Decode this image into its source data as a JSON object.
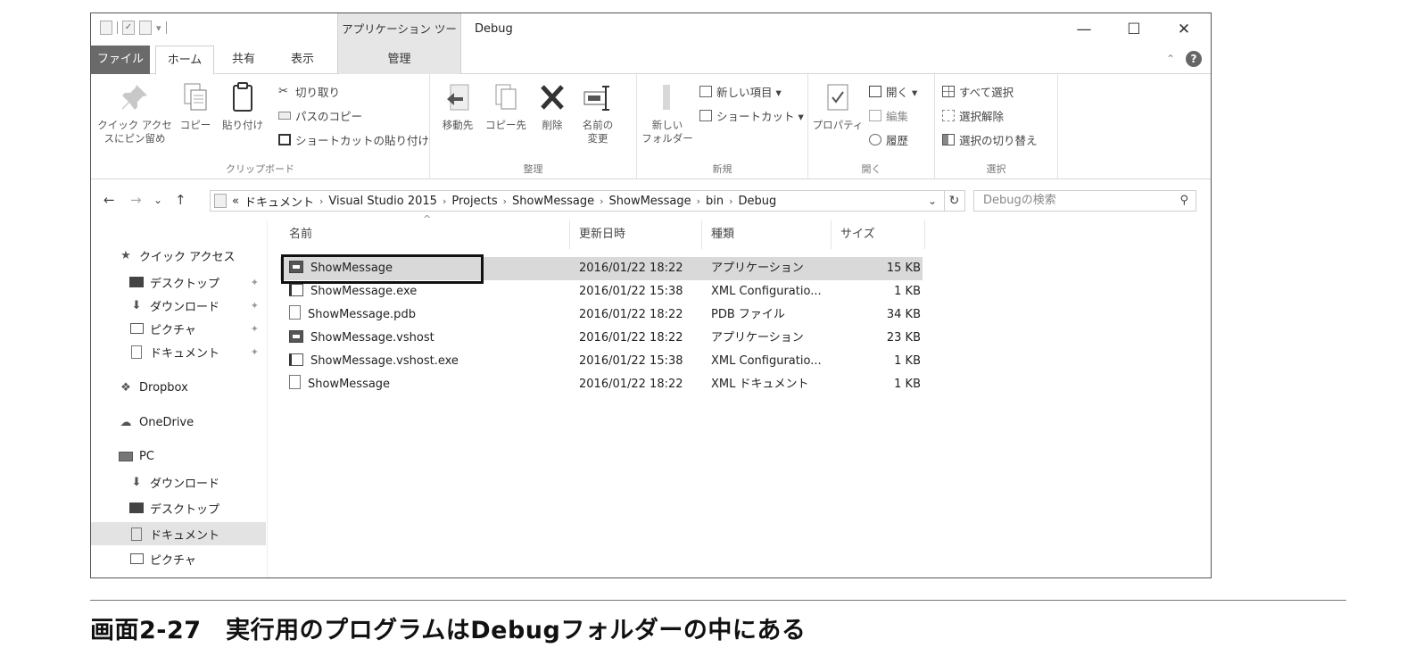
{
  "window": {
    "title": "Debug",
    "context_tab_group": "アプリケーション ツール",
    "minimize": "—",
    "maximize": "☐",
    "close": "✕"
  },
  "tabs": {
    "file": "ファイル",
    "home": "ホーム",
    "share": "共有",
    "view": "表示",
    "manage": "管理"
  },
  "ribbon": {
    "clipboard": {
      "group": "クリップボード",
      "pin_line1": "クイック アクセ",
      "pin_line2": "スにピン留め",
      "copy": "コピー",
      "paste": "貼り付け",
      "cut": "切り取り",
      "copy_path": "パスのコピー",
      "paste_shortcut": "ショートカットの貼り付け"
    },
    "organize": {
      "group": "整理",
      "move_to": "移動先",
      "copy_to": "コピー先",
      "delete": "削除",
      "rename_line1": "名前の",
      "rename_line2": "変更"
    },
    "new": {
      "group": "新規",
      "new_folder_line1": "新しい",
      "new_folder_line2": "フォルダー",
      "new_item": "新しい項目 ▾",
      "easy_access": "ショートカット ▾"
    },
    "open": {
      "group": "開く",
      "properties": "プロパティ",
      "open": "開く ▾",
      "edit": "編集",
      "history": "履歴"
    },
    "select": {
      "group": "選択",
      "select_all": "すべて選択",
      "select_none": "選択解除",
      "invert": "選択の切り替え"
    }
  },
  "address": {
    "back": "←",
    "forward": "→",
    "recent": "⌄",
    "up": "↑",
    "overflow": "«",
    "crumbs": [
      "ドキュメント",
      "Visual Studio 2015",
      "Projects",
      "ShowMessage",
      "ShowMessage",
      "bin",
      "Debug"
    ],
    "separator": "›",
    "dropdown": "⌄",
    "refresh": "↻",
    "search_placeholder": "Debugの検索",
    "search_icon": "⚲"
  },
  "nav": {
    "quick_access": "クイック アクセス",
    "items_pinned": [
      "デスクトップ",
      "ダウンロード",
      "ピクチャ",
      "ドキュメント"
    ],
    "dropbox": "Dropbox",
    "onedrive": "OneDrive",
    "pc": "PC",
    "pc_items": [
      "ダウンロード",
      "デスクトップ",
      "ドキュメント",
      "ピクチャ"
    ]
  },
  "columns": {
    "name": "名前",
    "modified": "更新日時",
    "type": "種類",
    "size": "サイズ"
  },
  "files": [
    {
      "name": "ShowMessage",
      "modified": "2016/01/22 18:22",
      "type": "アプリケーション",
      "size": "15 KB",
      "icon": "app-icon"
    },
    {
      "name": "ShowMessage.exe",
      "modified": "2016/01/22 15:38",
      "type": "XML Configuratio...",
      "size": "1 KB",
      "icon": "config-icon"
    },
    {
      "name": "ShowMessage.pdb",
      "modified": "2016/01/22 18:22",
      "type": "PDB ファイル",
      "size": "34 KB",
      "icon": "file-icon"
    },
    {
      "name": "ShowMessage.vshost",
      "modified": "2016/01/22 18:22",
      "type": "アプリケーション",
      "size": "23 KB",
      "icon": "app-icon"
    },
    {
      "name": "ShowMessage.vshost.exe",
      "modified": "2016/01/22 15:38",
      "type": "XML Configuratio...",
      "size": "1 KB",
      "icon": "config-icon"
    },
    {
      "name": "ShowMessage",
      "modified": "2016/01/22 18:22",
      "type": "XML ドキュメント",
      "size": "1 KB",
      "icon": "file-icon"
    }
  ],
  "caption": "画面2-27　実行用のプログラムはDebugフォルダーの中にある"
}
